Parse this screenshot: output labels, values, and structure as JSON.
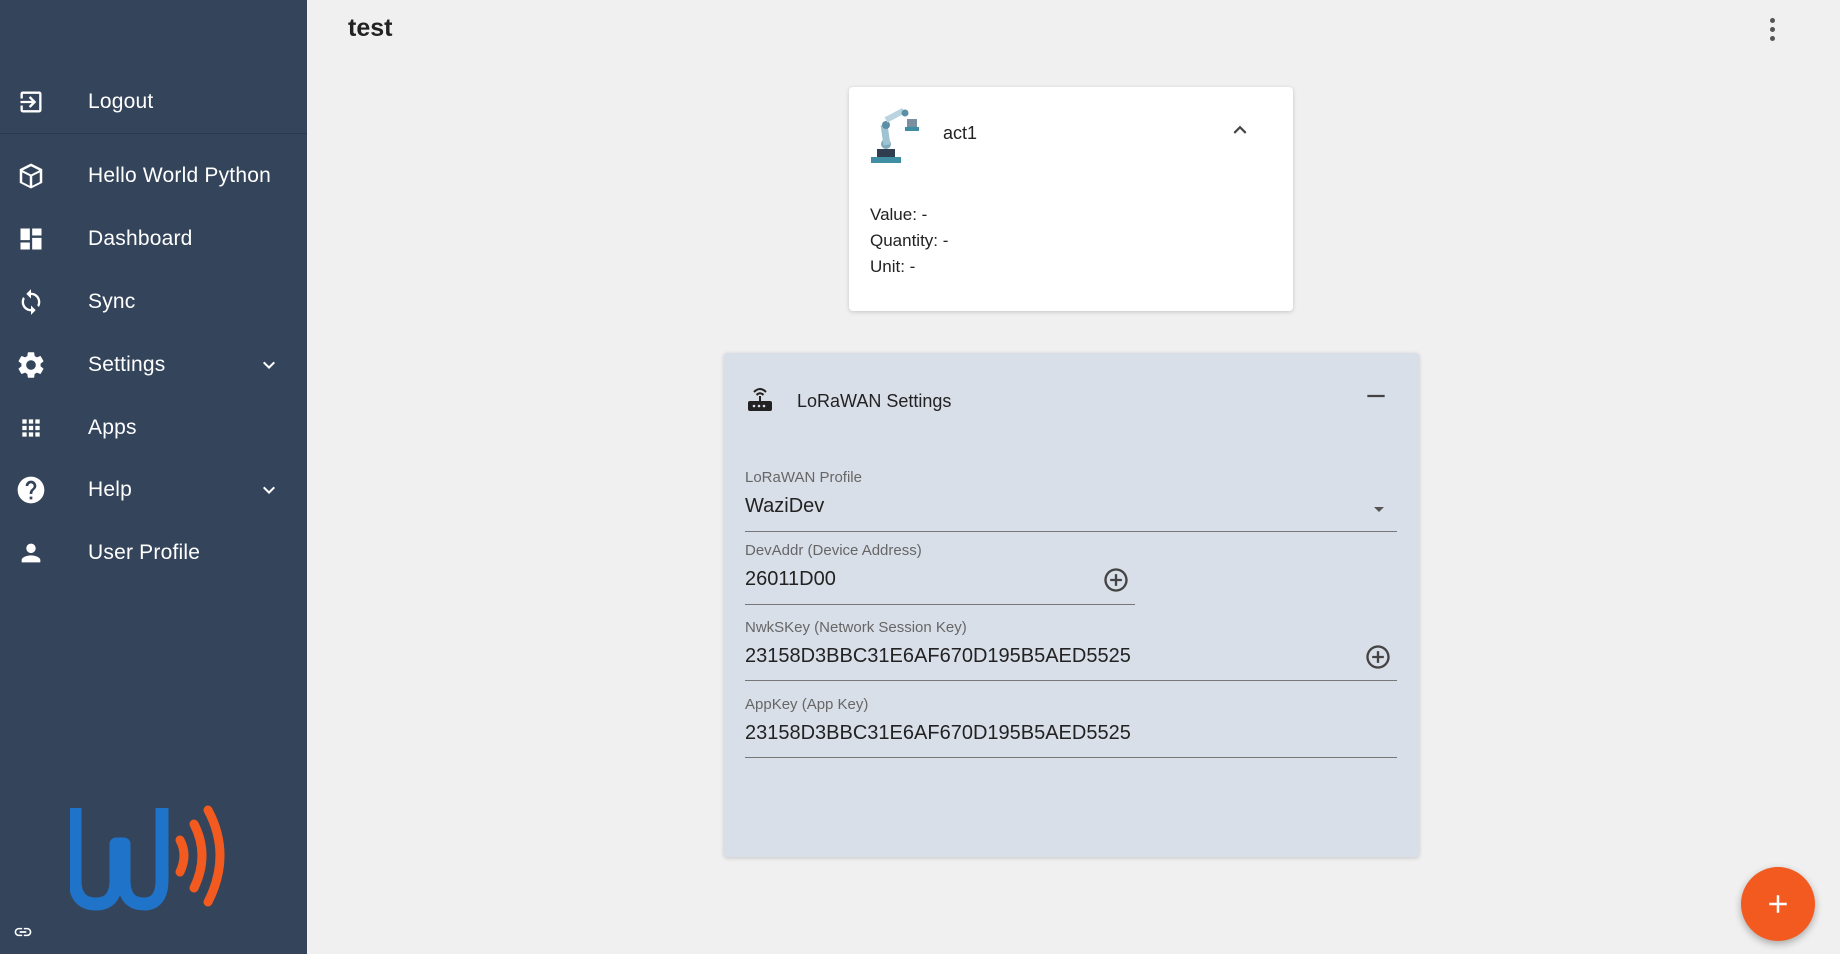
{
  "sidebar": {
    "items": [
      {
        "label": "Logout",
        "icon": "logout-icon"
      },
      {
        "label": "Hello World Python",
        "icon": "cube-icon"
      },
      {
        "label": "Dashboard",
        "icon": "dashboard-icon"
      },
      {
        "label": "Sync",
        "icon": "sync-icon"
      },
      {
        "label": "Settings",
        "icon": "gear-icon",
        "expandable": true
      },
      {
        "label": "Apps",
        "icon": "apps-grid-icon"
      },
      {
        "label": "Help",
        "icon": "help-icon",
        "expandable": true
      },
      {
        "label": "User Profile",
        "icon": "person-icon"
      }
    ],
    "logo_colors": {
      "blue": "#1f73c8",
      "orange": "#f25a1f"
    }
  },
  "header": {
    "title": "test"
  },
  "actuator": {
    "name": "act1",
    "value_line": "Value: -",
    "quantity_line": "Quantity: -",
    "unit_line": "Unit: -"
  },
  "lorawan": {
    "title": "LoRaWAN Settings",
    "profile": {
      "label": "LoRaWAN Profile",
      "value": "WaziDev"
    },
    "devaddr": {
      "label": "DevAddr (Device Address)",
      "value": "26011D00"
    },
    "nwkskey": {
      "label": "NwkSKey (Network Session Key)",
      "value": "23158D3BBC31E6AF670D195B5AED5525"
    },
    "appkey": {
      "label": "AppKey (App Key)",
      "value": "23158D3BBC31E6AF670D195B5AED5525"
    }
  },
  "colors": {
    "sidebar_bg": "#34445a",
    "accent": "#f25a1f",
    "card_lora_bg": "#d9dfe9"
  }
}
